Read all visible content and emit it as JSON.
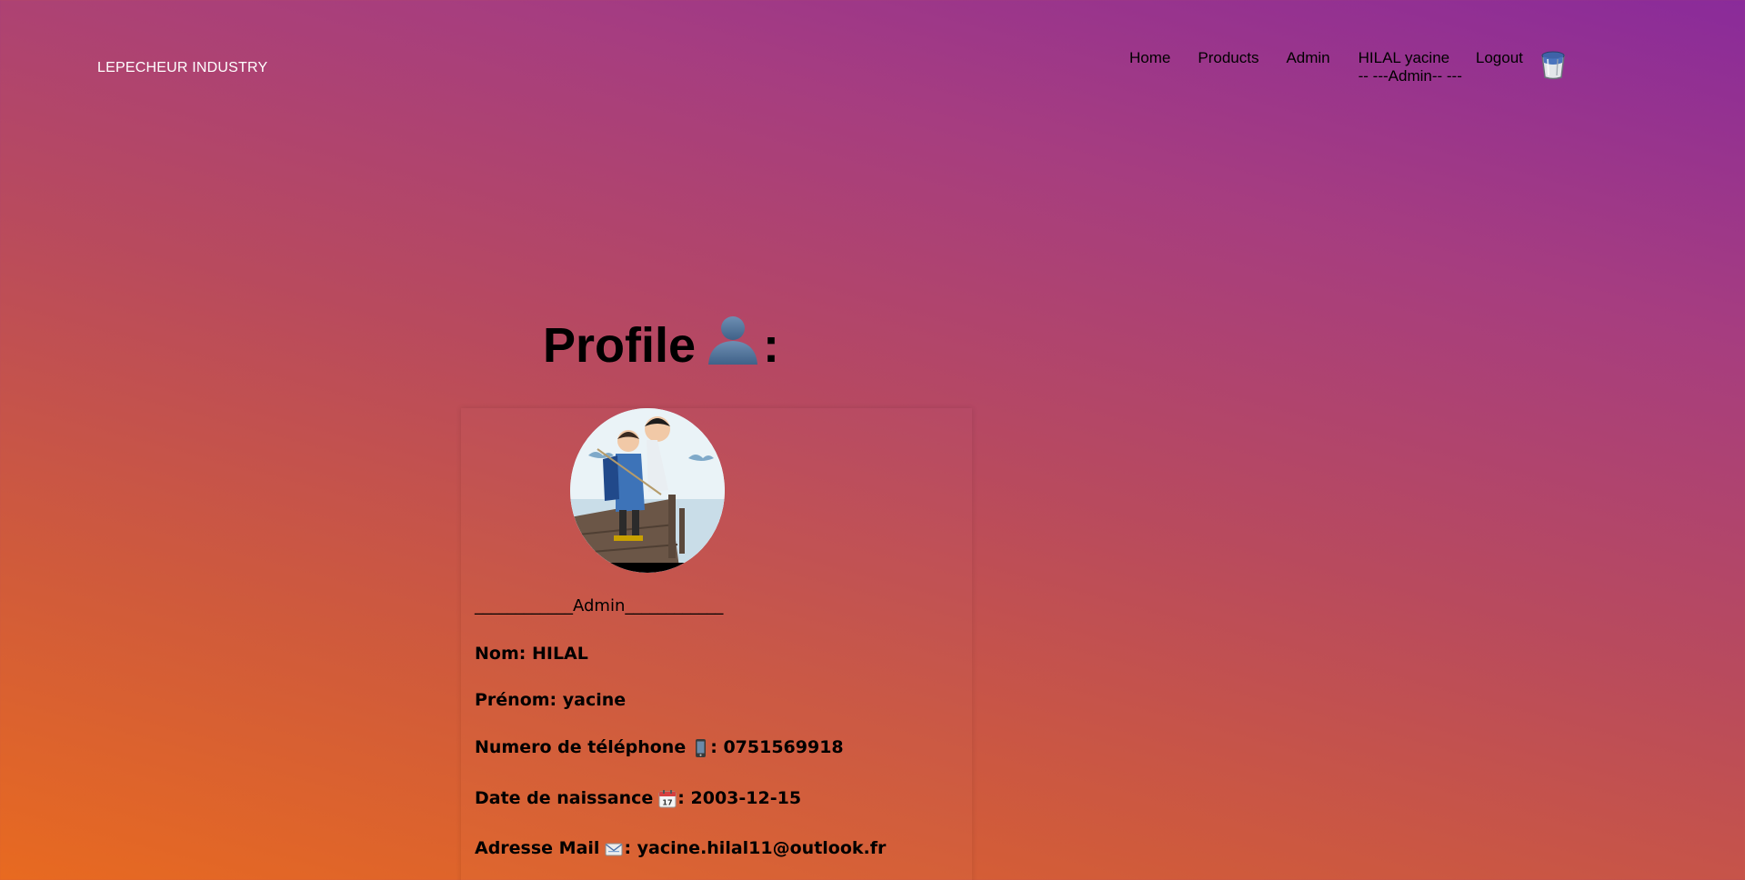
{
  "header": {
    "brand": "LEPECHEUR INDUSTRY",
    "nav": {
      "home": "Home",
      "products": "Products",
      "admin": "Admin",
      "user_name": "HILAL yacine",
      "user_role": "-- ---Admin-- ---",
      "logout": "Logout"
    },
    "cart_icon": "bucket-icon"
  },
  "profile": {
    "title": "Profile",
    "title_suffix": ":",
    "title_icon": "person-silhouette-icon",
    "role_line": "____________Admin____________",
    "fields": {
      "nom": {
        "label": "Nom:",
        "value": "HILAL"
      },
      "prenom": {
        "label": "Prénom:",
        "value": "yacine"
      },
      "phone": {
        "label": "Numero de téléphone",
        "sep": ":",
        "value": "0751569918",
        "icon": "mobile-phone-icon"
      },
      "birth": {
        "label": "Date de naissance",
        "sep": ":",
        "value": "2003-12-15",
        "icon": "calendar-icon"
      },
      "mail": {
        "label": "Adresse Mail",
        "sep": ":",
        "value": "yacine.hilal11@outlook.fr",
        "icon": "envelope-icon"
      }
    }
  },
  "colors": {
    "gradient_top": "#8a2b9a",
    "gradient_bottom": "#e86a20",
    "brand_text": "#ffffff"
  }
}
